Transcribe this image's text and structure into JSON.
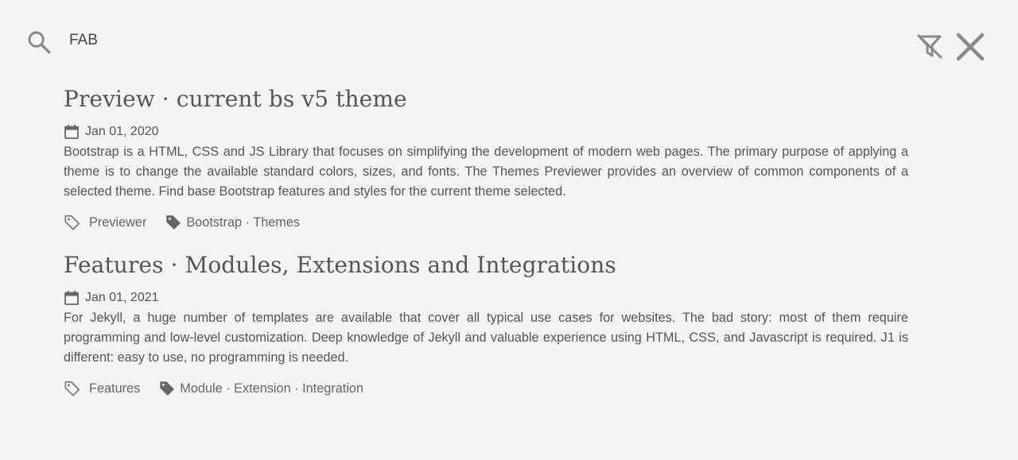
{
  "search": {
    "query": "FAB",
    "icon": "search-icon"
  },
  "toolbar": {
    "clear_filter_icon": "filter-off-icon",
    "close_icon": "close-icon"
  },
  "results": [
    {
      "title": "Preview · current bs v5 theme",
      "date": "Jan 01, 2020",
      "excerpt": "Bootstrap is a HTML, CSS and JS Library that focuses on simplifying the development of modern web pages. The primary purpose of applying a theme is to change the available standard colors, sizes, and fonts. The Themes Previewer provides an overview of common components of a selected theme. Find base Bootstrap features and styles for the current theme selected.",
      "category": "Previewer",
      "tags": "Bootstrap · Themes"
    },
    {
      "title": "Features · Modules, Extensions and Integrations",
      "date": "Jan 01, 2021",
      "excerpt": "For Jekyll, a huge number of templates are available that cover all typical use cases for websites. The bad story: most of them require programming and low-level customization. Deep knowledge of Jekyll and valuable experience using HTML, CSS, and Javascript is required. J1 is different: easy to use, no programming is needed.",
      "category": "Features",
      "tags": "Module · Extension · Integration"
    }
  ],
  "colors": {
    "background": "#f4f4f4",
    "text": "#555555",
    "icon": "#888888"
  }
}
